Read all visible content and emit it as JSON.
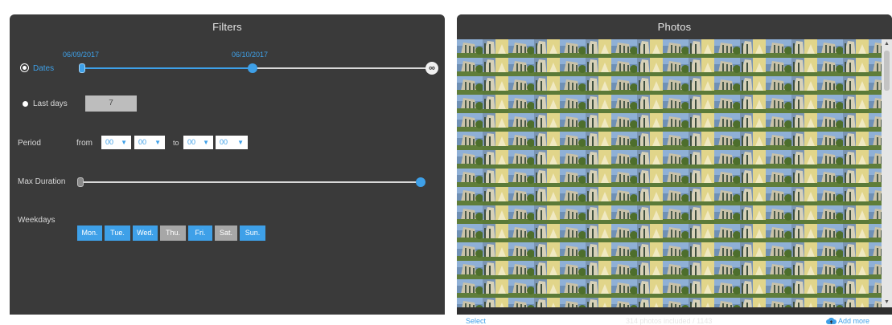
{
  "filters": {
    "title": "Filters",
    "dates": {
      "label": "Dates",
      "start_date": "06/09/2017",
      "end_date": "06/10/2017",
      "end_cap_symbol": "∞"
    },
    "last_days": {
      "label": "Last days",
      "value": "7"
    },
    "period": {
      "label": "Period",
      "from_label": "from",
      "to_label": "to",
      "from_hour": "00",
      "from_minute": "00",
      "to_hour": "00",
      "to_minute": "00"
    },
    "max_duration": {
      "label": "Max Duration",
      "fraction": 1.0
    },
    "weekdays": {
      "label": "Weekdays",
      "days": [
        {
          "label": "Mon.",
          "active": true
        },
        {
          "label": "Tue.",
          "active": true
        },
        {
          "label": "Wed.",
          "active": true
        },
        {
          "label": "Thu.",
          "active": false
        },
        {
          "label": "Fri.",
          "active": true
        },
        {
          "label": "Sat.",
          "active": false
        },
        {
          "label": "Sun.",
          "active": true
        }
      ]
    }
  },
  "photos": {
    "title": "Photos",
    "select_label": "Select",
    "summary": "314 photos included / 1143",
    "add_more_label": "Add more"
  },
  "colors": {
    "accent": "#3ea0e8",
    "panel": "#3a3a3a",
    "inactive": "#a7a7a7"
  },
  "icons": {
    "add_more": "cloud-upload-icon",
    "scroll_up": "triangle-up",
    "scroll_down": "triangle-down"
  }
}
